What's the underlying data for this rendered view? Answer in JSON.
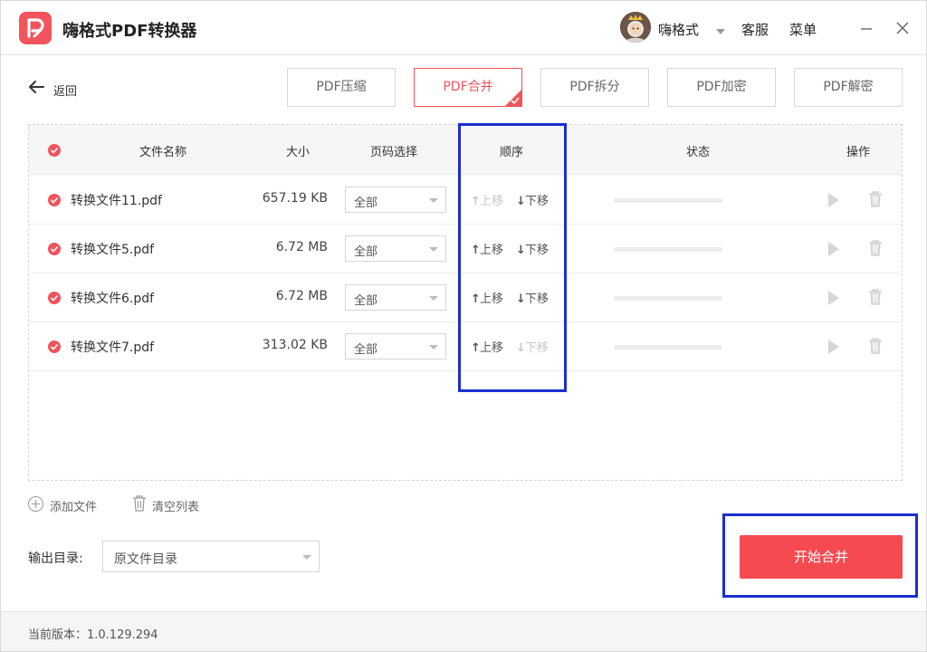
{
  "app": {
    "title": "嗨格式PDF转换器",
    "accent_color": "#f0545b",
    "logo_icon": "pdf-logo-icon"
  },
  "header": {
    "username": "嗨格式",
    "service_label": "客服",
    "menu_label": "菜单"
  },
  "toolbar": {
    "back_label": "返回",
    "tabs": [
      {
        "label": "PDF压缩",
        "active": false
      },
      {
        "label": "PDF合并",
        "active": true
      },
      {
        "label": "PDF拆分",
        "active": false
      },
      {
        "label": "PDF加密",
        "active": false
      },
      {
        "label": "PDF解密",
        "active": false
      }
    ]
  },
  "table": {
    "columns": {
      "name": "文件名称",
      "size": "大小",
      "page": "页码选择",
      "order": "顺序",
      "status": "状态",
      "actions": "操作"
    },
    "move_up_label": "上移",
    "move_down_label": "下移",
    "rows": [
      {
        "name": "转换文件11.pdf",
        "size": "657.19 KB",
        "pages": "全部",
        "up_enabled": false,
        "down_enabled": true
      },
      {
        "name": "转换文件5.pdf",
        "size": "6.72 MB",
        "pages": "全部",
        "up_enabled": true,
        "down_enabled": true
      },
      {
        "name": "转换文件6.pdf",
        "size": "6.72 MB",
        "pages": "全部",
        "up_enabled": true,
        "down_enabled": true
      },
      {
        "name": "转换文件7.pdf",
        "size": "313.02 KB",
        "pages": "全部",
        "up_enabled": true,
        "down_enabled": false
      }
    ]
  },
  "actions": {
    "add_file_label": "添加文件",
    "clear_list_label": "清空列表"
  },
  "output": {
    "label": "输出目录:",
    "value": "原文件目录"
  },
  "start_button_label": "开始合并",
  "footer": {
    "version_text": "当前版本：1.0.129.294"
  }
}
